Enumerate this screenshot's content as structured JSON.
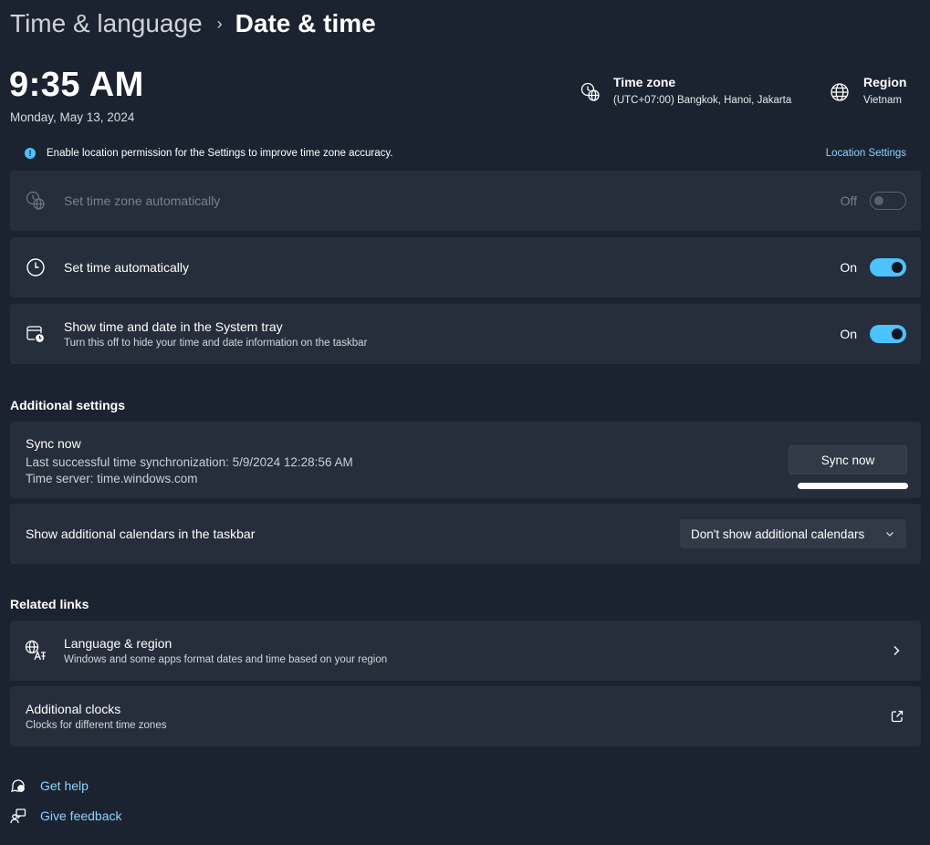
{
  "breadcrumb": {
    "parent": "Time & language",
    "separator": "›",
    "current": "Date & time"
  },
  "clock": {
    "time": "9:35 AM",
    "date": "Monday, May 13, 2024"
  },
  "time_zone": {
    "title": "Time zone",
    "value": "(UTC+07:00) Bangkok, Hanoi, Jakarta",
    "icon": "globe-clock-icon"
  },
  "region": {
    "title": "Region",
    "value": "Vietnam",
    "icon": "globe-icon"
  },
  "banner": {
    "icon": "info-icon",
    "glyph": "!",
    "text": "Enable location permission for the Settings to improve time zone accuracy.",
    "link": "Location Settings"
  },
  "settings": {
    "auto_timezone": {
      "label": "Set time zone automatically",
      "state": "Off",
      "enabled": false,
      "icon": "globe-clock-icon"
    },
    "auto_time": {
      "label": "Set time automatically",
      "state": "On",
      "icon": "clock-icon"
    },
    "tray": {
      "label": "Show time and date in the System tray",
      "sub": "Turn this off to hide your time and date information on the taskbar",
      "state": "On",
      "icon": "calendar-clock-icon"
    }
  },
  "additional": {
    "title": "Additional settings",
    "sync": {
      "title": "Sync now",
      "last": "Last successful time synchronization: 5/9/2024 12:28:56 AM",
      "server": "Time server: time.windows.com",
      "button": "Sync now"
    },
    "calendars": {
      "label": "Show additional calendars in the taskbar",
      "selected": "Don't show additional calendars"
    }
  },
  "related": {
    "title": "Related links",
    "language": {
      "label": "Language & region",
      "sub": "Windows and some apps format dates and time based on your region",
      "icon": "language-icon"
    },
    "clocks": {
      "label": "Additional clocks",
      "sub": "Clocks for different time zones",
      "icon": "open-external-icon"
    }
  },
  "footer": {
    "help": "Get help",
    "feedback": "Give feedback"
  },
  "colors": {
    "accent": "#4cc2ff",
    "background": "#1c2330",
    "card": "#262d3b",
    "link": "#8ad3ff"
  }
}
